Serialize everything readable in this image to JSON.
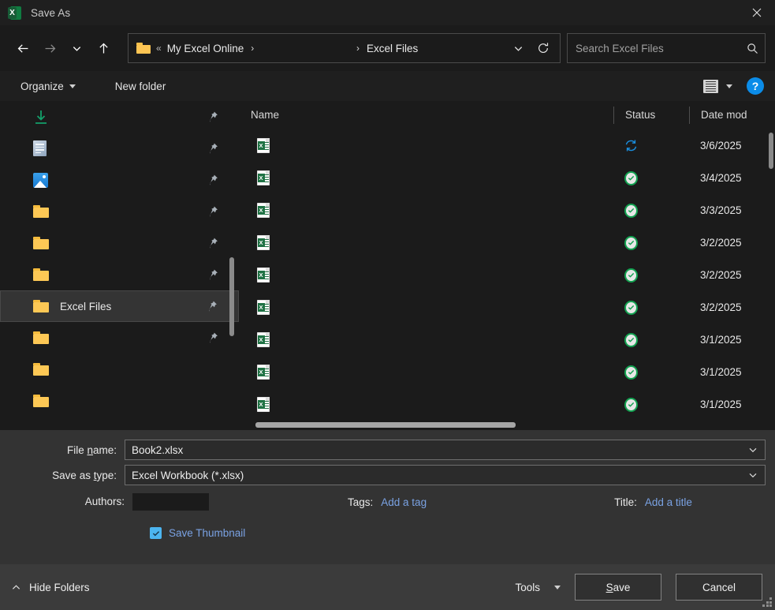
{
  "window": {
    "title": "Save As",
    "app_icon": "excel-icon",
    "app_icon_letter": "X",
    "close_label": "✕"
  },
  "nav": {
    "back": "back-arrow",
    "forward": "forward-arrow",
    "recent": "recent-locations-chevron",
    "up": "up-arrow",
    "breadcrumb": {
      "folder_icon": "folder-icon",
      "overflow": "«",
      "items": [
        {
          "label": "My Excel Online",
          "separator": "›"
        },
        {
          "label": "Excel Files",
          "separator": "›"
        }
      ],
      "dropdown_icon": "chevron-down-icon",
      "refresh_icon": "refresh-icon"
    },
    "search": {
      "placeholder": "Search Excel Files",
      "value": "",
      "icon": "search-icon"
    }
  },
  "commandbar": {
    "organize_label": "Organize",
    "new_folder_label": "New folder",
    "view_layout_icon": "list-view-icon",
    "help_label": "?"
  },
  "sidebar": {
    "items": [
      {
        "label": "",
        "icon": "downloads-icon",
        "pinned": true,
        "selected": false
      },
      {
        "label": "",
        "icon": "documents-icon",
        "pinned": true,
        "selected": false
      },
      {
        "label": "",
        "icon": "pictures-icon",
        "pinned": true,
        "selected": false
      },
      {
        "label": "",
        "icon": "folder-icon",
        "pinned": true,
        "selected": false
      },
      {
        "label": "",
        "icon": "folder-icon",
        "pinned": true,
        "selected": false
      },
      {
        "label": "",
        "icon": "folder-icon",
        "pinned": true,
        "selected": false
      },
      {
        "label": "Excel Files",
        "icon": "folder-icon",
        "pinned": true,
        "selected": true
      },
      {
        "label": "",
        "icon": "folder-icon",
        "pinned": true,
        "selected": false
      },
      {
        "label": "",
        "icon": "folder-icon",
        "pinned": false,
        "selected": false
      },
      {
        "label": "",
        "icon": "folder-icon",
        "pinned": false,
        "selected": false
      }
    ]
  },
  "filelist": {
    "columns": [
      "Name",
      "Status",
      "Date mod"
    ],
    "rows": [
      {
        "name": "",
        "icon": "xlsx-file-icon",
        "status": "syncing",
        "date": "3/6/2025"
      },
      {
        "name": "",
        "icon": "xlsx-file-icon",
        "status": "synced",
        "date": "3/4/2025"
      },
      {
        "name": "",
        "icon": "xlsx-file-icon",
        "status": "synced",
        "date": "3/3/2025"
      },
      {
        "name": "",
        "icon": "xlsx-file-icon",
        "status": "synced",
        "date": "3/2/2025"
      },
      {
        "name": "",
        "icon": "xlsx-file-icon",
        "status": "synced",
        "date": "3/2/2025"
      },
      {
        "name": "",
        "icon": "xlsx-file-icon",
        "status": "synced",
        "date": "3/2/2025"
      },
      {
        "name": "",
        "icon": "xlsx-file-icon",
        "status": "synced",
        "date": "3/1/2025"
      },
      {
        "name": "",
        "icon": "xlsx-file-icon",
        "status": "synced",
        "date": "3/1/2025"
      },
      {
        "name": "",
        "icon": "xlsx-file-icon",
        "status": "synced",
        "date": "3/1/2025"
      }
    ]
  },
  "form": {
    "filename_label_pre": "File ",
    "filename_label_key": "n",
    "filename_label_post": "ame:",
    "filename_value": "Book2.xlsx",
    "savetype_label_pre": "Save as ",
    "savetype_label_key": "t",
    "savetype_label_post": "ype:",
    "savetype_value": "Excel Workbook (*.xlsx)",
    "authors_label": "Authors:",
    "authors_value": "",
    "tags_label": "Tags:",
    "tags_link": "Add a tag",
    "title_label": "Title:",
    "title_link": "Add a title",
    "thumbnail_label": "Save Thumbnail",
    "thumbnail_checked": true
  },
  "footer": {
    "hide_folders_label": "Hide Folders",
    "hide_folders_icon": "chevron-up-icon",
    "tools_label": "Tools",
    "tools_key": "l",
    "save_label_pre": "",
    "save_key": "S",
    "save_label_post": "ave",
    "cancel_label": "Cancel"
  },
  "colors": {
    "accent_blue": "#0b8ce8",
    "excel_green": "#107c41",
    "link_blue": "#7aa2e3",
    "sync_blue": "#1a8fe0",
    "ok_green": "#12a150",
    "folder_yellow": "#fdc855",
    "checkbox_cyan": "#4cb5f0"
  }
}
